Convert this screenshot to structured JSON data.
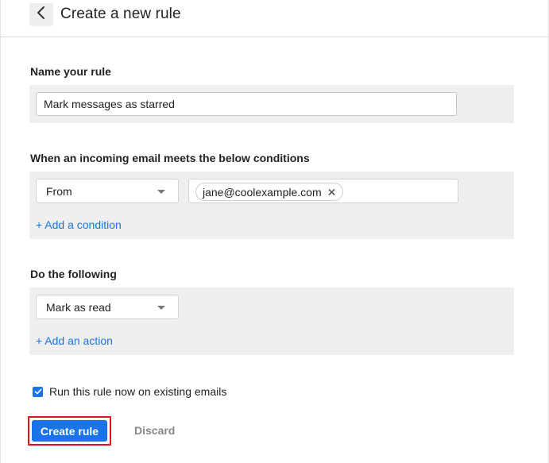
{
  "header": {
    "title": "Create a new rule",
    "back_icon": "chevron-left-icon"
  },
  "name_section": {
    "label": "Name your rule",
    "rule_name_value": "Mark messages as starred"
  },
  "conditions_section": {
    "label": "When an incoming email meets the below conditions",
    "field_select": "From",
    "value_chip": "jane@coolexample.com",
    "chip_close_glyph": "✕",
    "add_condition": "+ Add a condition"
  },
  "actions_section": {
    "label": "Do the following",
    "action_select": "Mark as read",
    "add_action": "+ Add an action"
  },
  "options": {
    "run_now_label": "Run this rule now on existing emails",
    "run_now_checked": true
  },
  "footer": {
    "create_label": "Create rule",
    "discard_label": "Discard"
  },
  "colors": {
    "accent": "#1a73e8",
    "panel_bg": "#efefef",
    "highlight_border": "#e0101c"
  }
}
